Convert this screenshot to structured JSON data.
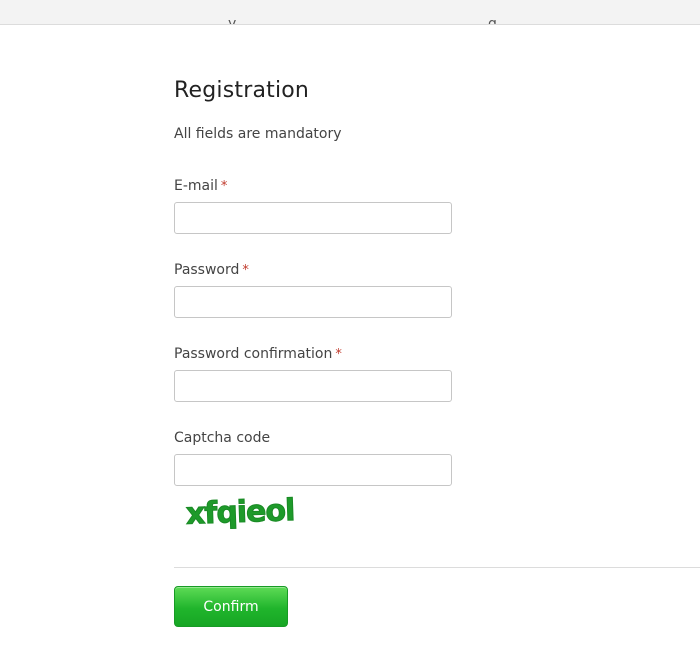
{
  "form": {
    "title": "Registration",
    "subtitle": "All fields are mandatory",
    "required_marker": "*",
    "fields": [
      {
        "label": "E-mail",
        "required": true,
        "value": "",
        "placeholder": ""
      },
      {
        "label": "Password",
        "required": true,
        "value": "",
        "placeholder": ""
      },
      {
        "label": "Password confirmation",
        "required": true,
        "value": "",
        "placeholder": ""
      },
      {
        "label": "Captcha code",
        "required": false,
        "value": "",
        "placeholder": ""
      }
    ],
    "captcha_text": "xfqieol",
    "confirm_label": "Confirm"
  },
  "colors": {
    "required": "#c0392b",
    "button_green": "#20b52c",
    "captcha_green": "#1e9a2a"
  }
}
